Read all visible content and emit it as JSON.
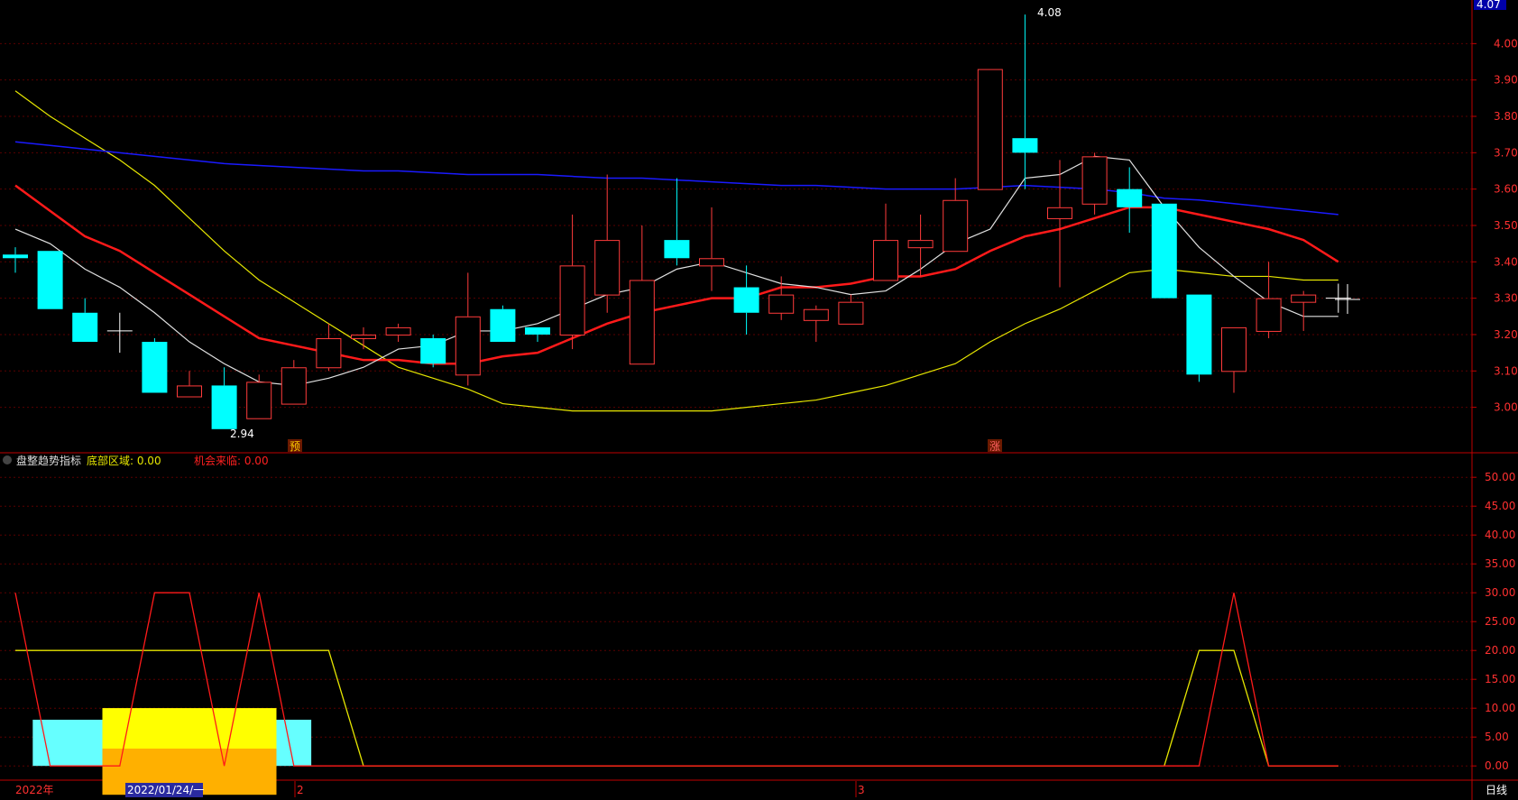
{
  "colors": {
    "background": "#000000",
    "up_candle": "#ff3b3b",
    "down_candle": "#00ffff",
    "doji": "#ffffff",
    "ma_white": "#e0e0e0",
    "ma_red": "#ff1a1a",
    "ma_yellow": "#e6e600",
    "ma_blue": "#1a1aff",
    "axis_red": "#c00000",
    "grid": "#5a0000"
  },
  "overlay": {
    "high_marker": "4.08",
    "low_marker": "2.94",
    "badge_yu": "预",
    "badge_zhang": "涨",
    "axis_top_price": "4.07"
  },
  "indicator_header": {
    "name": "盘整趋势指标",
    "bottom_zone": "底部区域: 0.00",
    "opportunity": "机会来临: 0.00"
  },
  "bottom_bar": {
    "year": "2022年",
    "date_box": "2022/01/24/一",
    "month_2": "2",
    "month_3": "3",
    "period": "日线"
  },
  "chart_data": [
    {
      "type": "candlestick",
      "yticks": [
        "4.00",
        "3.90",
        "3.80",
        "3.70",
        "3.60",
        "3.50",
        "3.40",
        "3.30",
        "3.20",
        "3.10",
        "3.00"
      ],
      "ylim": [
        2.88,
        4.11
      ],
      "candles": [
        [
          3.42,
          3.44,
          3.37,
          3.41
        ],
        [
          3.43,
          3.43,
          3.27,
          3.27
        ],
        [
          3.26,
          3.3,
          3.18,
          3.18
        ],
        [
          3.21,
          3.26,
          3.15,
          3.21
        ],
        [
          3.18,
          3.19,
          3.04,
          3.04
        ],
        [
          3.03,
          3.1,
          3.03,
          3.06
        ],
        [
          3.06,
          3.11,
          2.94,
          2.94
        ],
        [
          2.97,
          3.09,
          2.97,
          3.07
        ],
        [
          3.01,
          3.13,
          3.01,
          3.11
        ],
        [
          3.11,
          3.23,
          3.1,
          3.19
        ],
        [
          3.19,
          3.22,
          3.16,
          3.2
        ],
        [
          3.2,
          3.23,
          3.18,
          3.22
        ],
        [
          3.19,
          3.2,
          3.11,
          3.12
        ],
        [
          3.09,
          3.37,
          3.06,
          3.25
        ],
        [
          3.27,
          3.28,
          3.18,
          3.18
        ],
        [
          3.22,
          3.22,
          3.18,
          3.2
        ],
        [
          3.2,
          3.53,
          3.16,
          3.39
        ],
        [
          3.31,
          3.64,
          3.26,
          3.46
        ],
        [
          3.12,
          3.5,
          3.12,
          3.35
        ],
        [
          3.46,
          3.63,
          3.39,
          3.41
        ],
        [
          3.39,
          3.55,
          3.32,
          3.41
        ],
        [
          3.33,
          3.39,
          3.2,
          3.26
        ],
        [
          3.26,
          3.36,
          3.24,
          3.31
        ],
        [
          3.24,
          3.28,
          3.18,
          3.27
        ],
        [
          3.23,
          3.31,
          3.23,
          3.29
        ],
        [
          3.35,
          3.56,
          3.35,
          3.46
        ],
        [
          3.44,
          3.53,
          3.36,
          3.46
        ],
        [
          3.43,
          3.63,
          3.43,
          3.57
        ],
        [
          3.6,
          3.93,
          3.6,
          3.93
        ],
        [
          3.74,
          4.08,
          3.6,
          3.7
        ],
        [
          3.52,
          3.68,
          3.33,
          3.55
        ],
        [
          3.56,
          3.7,
          3.53,
          3.69
        ],
        [
          3.6,
          3.66,
          3.48,
          3.55
        ],
        [
          3.56,
          3.56,
          3.3,
          3.3
        ],
        [
          3.31,
          3.31,
          3.07,
          3.09
        ],
        [
          3.1,
          3.22,
          3.04,
          3.22
        ],
        [
          3.21,
          3.4,
          3.19,
          3.3
        ],
        [
          3.29,
          3.32,
          3.21,
          3.31
        ],
        [
          3.3,
          3.34,
          3.26,
          3.3
        ]
      ],
      "ma_white": [
        3.49,
        3.45,
        3.38,
        3.33,
        3.26,
        3.18,
        3.12,
        3.07,
        3.06,
        3.08,
        3.11,
        3.16,
        3.17,
        3.21,
        3.21,
        3.23,
        3.27,
        3.31,
        3.33,
        3.38,
        3.4,
        3.37,
        3.34,
        3.33,
        3.31,
        3.32,
        3.38,
        3.45,
        3.49,
        3.63,
        3.64,
        3.69,
        3.68,
        3.55,
        3.44,
        3.36,
        3.29,
        3.25,
        3.25
      ],
      "ma_red": [
        3.61,
        3.54,
        3.47,
        3.43,
        3.37,
        3.31,
        3.25,
        3.19,
        3.17,
        3.15,
        3.13,
        3.13,
        3.12,
        3.12,
        3.14,
        3.15,
        3.19,
        3.23,
        3.26,
        3.28,
        3.3,
        3.3,
        3.33,
        3.33,
        3.34,
        3.36,
        3.36,
        3.38,
        3.43,
        3.47,
        3.49,
        3.52,
        3.55,
        3.55,
        3.53,
        3.51,
        3.49,
        3.46,
        3.4
      ],
      "ma_yellow": [
        3.87,
        3.8,
        3.74,
        3.68,
        3.61,
        3.52,
        3.43,
        3.35,
        3.29,
        3.23,
        3.17,
        3.11,
        3.08,
        3.05,
        3.01,
        3.0,
        2.99,
        2.99,
        2.99,
        2.99,
        2.99,
        3.0,
        3.01,
        3.02,
        3.04,
        3.06,
        3.09,
        3.12,
        3.18,
        3.23,
        3.27,
        3.32,
        3.37,
        3.38,
        3.37,
        3.36,
        3.36,
        3.35,
        3.35
      ],
      "ma_blue": [
        3.73,
        3.72,
        3.71,
        3.7,
        3.69,
        3.68,
        3.67,
        3.665,
        3.66,
        3.655,
        3.65,
        3.65,
        3.645,
        3.64,
        3.64,
        3.64,
        3.635,
        3.63,
        3.63,
        3.625,
        3.62,
        3.615,
        3.61,
        3.61,
        3.605,
        3.6,
        3.6,
        3.6,
        3.605,
        3.61,
        3.605,
        3.6,
        3.59,
        3.575,
        3.57,
        3.56,
        3.55,
        3.54,
        3.53
      ]
    },
    {
      "type": "line",
      "title": "盘整趋势指标",
      "yticks": [
        "50.00",
        "45.00",
        "40.00",
        "35.00",
        "30.00",
        "25.00",
        "20.00",
        "15.00",
        "10.00",
        "5.00",
        "0.00"
      ],
      "ylim": [
        -2,
        53
      ],
      "series": [
        {
          "color": "#e6e600",
          "points": [
            [
              0,
              20
            ],
            [
              9,
              20
            ],
            [
              10,
              0
            ],
            [
              33,
              0
            ],
            [
              34,
              20
            ],
            [
              35,
              20
            ],
            [
              36,
              0
            ],
            [
              38,
              0
            ]
          ]
        },
        {
          "color": "#ff1a1a",
          "points": [
            [
              0,
              30
            ],
            [
              1,
              0
            ],
            [
              3,
              0
            ],
            [
              4,
              30
            ],
            [
              5,
              30
            ],
            [
              6,
              0
            ],
            [
              7,
              30
            ],
            [
              8,
              0
            ],
            [
              34,
              0
            ],
            [
              35,
              30
            ],
            [
              36,
              0
            ],
            [
              38,
              0
            ]
          ]
        }
      ],
      "bars": [
        {
          "x0": 0.5,
          "x1": 8.5,
          "y0": 0,
          "y1": 8,
          "color": "#66ffff"
        },
        {
          "x0": 2.5,
          "x1": 7.5,
          "y0": -5,
          "y1": 10,
          "color": "#ffb000"
        },
        {
          "x0": 2.5,
          "x1": 7.5,
          "y0": 3,
          "y1": 10,
          "color": "#ffff00"
        }
      ]
    }
  ]
}
